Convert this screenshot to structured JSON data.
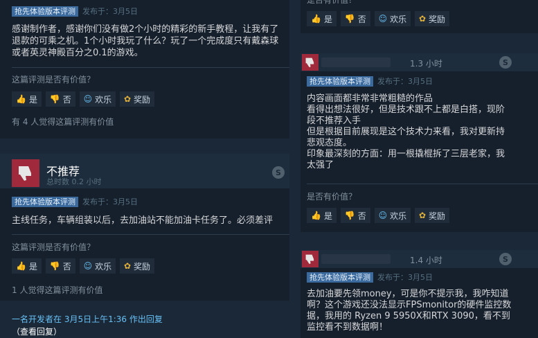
{
  "left_top": {
    "badge": "抢先体验版本评测",
    "posted": "发布于：3月5日",
    "lines": [
      "感谢制作者，感谢你们没有做2个小时的精彩的新手教程，让我有了",
      "退款的可乘之机。1个小时我玩了什么？玩了一个完成度只有戴森球",
      "或者英灵神殿百分之0.1的游戏。"
    ],
    "helpful_q": "这篇评测是否有价值？",
    "helpful_count": "有 4 人觉得这篇评测有价值"
  },
  "left_bottom": {
    "verdict": "不推荐",
    "hours": "总时数 0.2 小时",
    "badge": "抢先体验版本评测",
    "posted": "发布于：3月5日",
    "lines": [
      "主线任务，车辆组装以后，去加油站不能加油卡任务了。必须差评"
    ],
    "helpful_q": "这篇评测是否有价值？",
    "helpful_count": "1 人觉得这篇评测有价值",
    "dev_reply": "一名开发者在 3月5日上午1:36 作出回复",
    "view_reply": "（查看回复）"
  },
  "right_top": {
    "helpful_q_cut": "是否有价值？"
  },
  "right_mid": {
    "hours": "1.3 小时",
    "badge": "抢先体验版本评测",
    "posted": "发布于：3月5日",
    "lines": [
      "内容画面都非常非常粗糙的作品",
      "看得出想法很好，但是技术跟不上都是白搭，现阶",
      "段不推荐入手",
      "但是根据目前展现是这个技术力来看，我对更新持",
      "悲观态度。",
      "印象最深刻的方面：用一根撬棍拆了三层老家，我",
      "太强了"
    ],
    "helpful_q": "是否有价值？"
  },
  "right_bottom": {
    "hours": "1.4 小时",
    "badge": "抢先体验版本评测",
    "posted": "发布于：3月5日",
    "lines": [
      "去加油要先领money，可是你不提示我，我咋知道",
      "啊？这个游戏还没法显示FPSmonitor的硬件监控数",
      "据，我用的 Ryzen 9 5950X和RTX 3090，看不到",
      "监控看不到数据啊！"
    ]
  },
  "buttons": {
    "yes": "是",
    "no": "否",
    "funny": "欢乐",
    "award": "奖励"
  },
  "icons": {
    "yes": "thumbs-up-icon",
    "no": "thumbs-down-icon",
    "funny": "smiley-icon",
    "award": "award-icon",
    "steam": "steam-icon"
  },
  "colors": {
    "background": "#1b2838",
    "badge": "#3b6a9e",
    "negative": "#a0293b",
    "link": "#67c1f5"
  }
}
